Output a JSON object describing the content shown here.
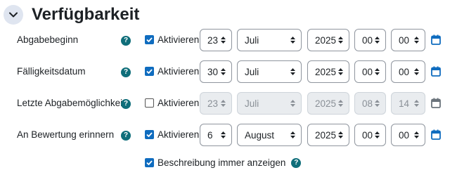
{
  "section": {
    "title": "Verfügbarkeit",
    "toggle_icon": "chevron-down-icon"
  },
  "colors": {
    "accent": "#0f6cbf",
    "help": "#0f6e7a",
    "toggle_bg": "#dfe5f0"
  },
  "rows": [
    {
      "label": "Abgabebeginn",
      "checkbox_label": "Aktivieren",
      "checked": true,
      "disabled": false,
      "day": "23",
      "month": "Juli",
      "year": "2025",
      "hour": "00",
      "minute": "00"
    },
    {
      "label": "Fälligkeitsdatum",
      "checkbox_label": "Aktivieren",
      "checked": true,
      "disabled": false,
      "day": "30",
      "month": "Juli",
      "year": "2025",
      "hour": "00",
      "minute": "00"
    },
    {
      "label": "Letzte Abgabemöglichkeit",
      "checkbox_label": "Aktivieren",
      "checked": false,
      "disabled": true,
      "day": "23",
      "month": "Juli",
      "year": "2025",
      "hour": "08",
      "minute": "14"
    },
    {
      "label": "An Bewertung erinnern",
      "checkbox_label": "Aktivieren",
      "checked": true,
      "disabled": false,
      "day": "6",
      "month": "August",
      "year": "2025",
      "hour": "00",
      "minute": "00"
    }
  ],
  "footer": {
    "label": "Beschreibung immer anzeigen",
    "checked": true,
    "help_icon": "help-icon"
  },
  "icons": {
    "help": "?",
    "calendar": "calendar-icon"
  }
}
